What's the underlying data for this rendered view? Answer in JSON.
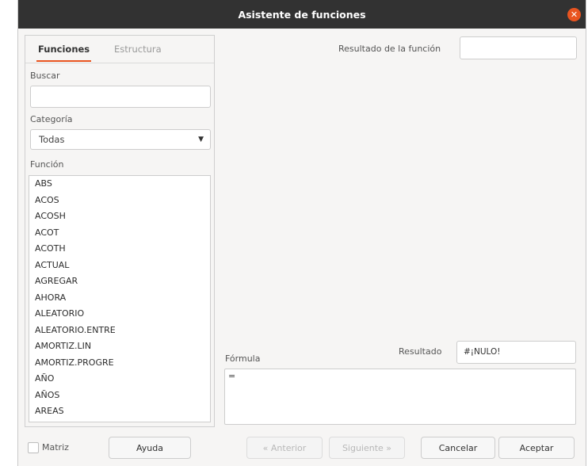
{
  "window": {
    "title": "Asistente de funciones"
  },
  "tabs": [
    {
      "label": "Funciones"
    },
    {
      "label": "Estructura"
    }
  ],
  "search": {
    "label": "Buscar",
    "value": ""
  },
  "category": {
    "label": "Categoría",
    "selected": "Todas"
  },
  "function_list": {
    "label": "Función",
    "items": [
      "ABS",
      "ACOS",
      "ACOSH",
      "ACOT",
      "ACOTH",
      "ACTUAL",
      "AGREGAR",
      "AHORA",
      "ALEATORIO",
      "ALEATORIO.ENTRE",
      "AMORTIZ.LIN",
      "AMORTIZ.PROGRE",
      "AÑO",
      "AÑOS",
      "AREAS"
    ]
  },
  "function_result": {
    "label": "Resultado de la función",
    "value": ""
  },
  "formula": {
    "label": "Fórmula",
    "value": "="
  },
  "result": {
    "label": "Resultado",
    "value": "#¡NULO!"
  },
  "bottom": {
    "matrix_label": "Matriz",
    "help": "Ayuda",
    "previous": "« Anterior",
    "next": "Siguiente »",
    "cancel": "Cancelar",
    "accept": "Aceptar"
  },
  "colors": {
    "accent": "#e95420",
    "titlebar": "#323232"
  }
}
